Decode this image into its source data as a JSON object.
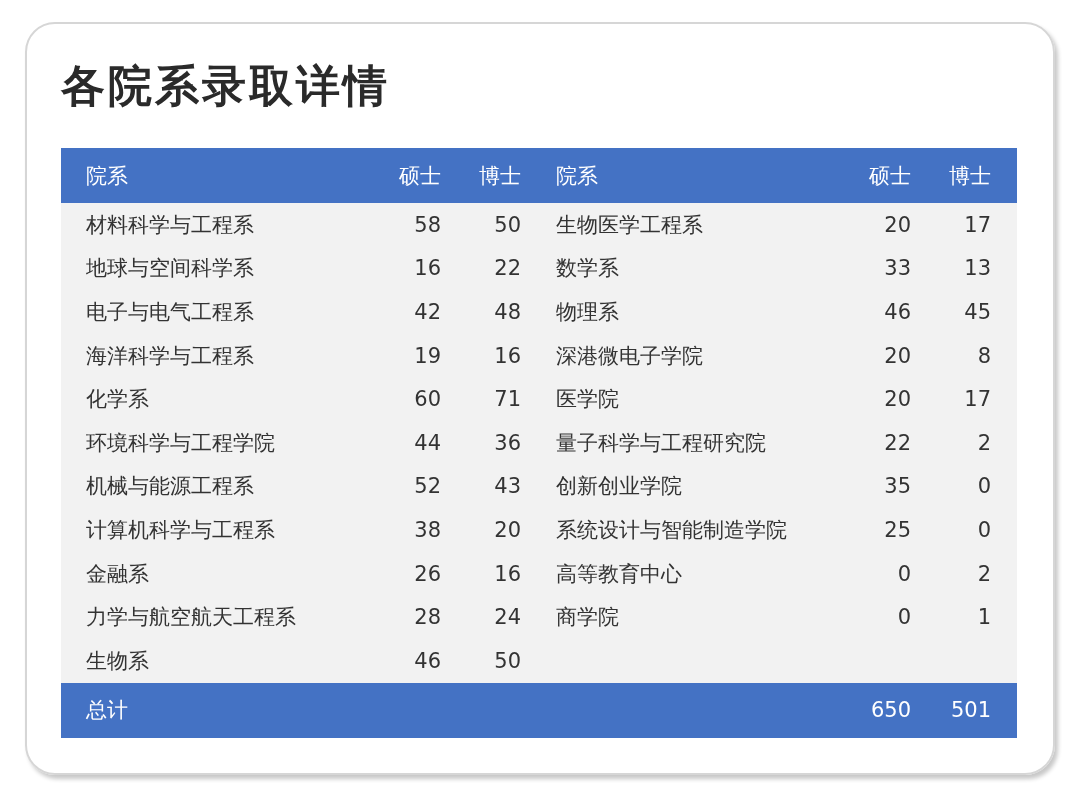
{
  "title": "各院系录取详情",
  "table": {
    "columns": [
      "院系",
      "硕士",
      "博士",
      "院系",
      "硕士",
      "博士"
    ],
    "rows": [
      [
        "材料科学与工程系",
        "58",
        "50",
        "生物医学工程系",
        "20",
        "17"
      ],
      [
        "地球与空间科学系",
        "16",
        "22",
        "数学系",
        "33",
        "13"
      ],
      [
        "电子与电气工程系",
        "42",
        "48",
        "物理系",
        "46",
        "45"
      ],
      [
        "海洋科学与工程系",
        "19",
        "16",
        "深港微电子学院",
        "20",
        "8"
      ],
      [
        "化学系",
        "60",
        "71",
        "医学院",
        "20",
        "17"
      ],
      [
        "环境科学与工程学院",
        "44",
        "36",
        "量子科学与工程研究院",
        "22",
        "2"
      ],
      [
        "机械与能源工程系",
        "52",
        "43",
        "创新创业学院",
        "35",
        "0"
      ],
      [
        "计算机科学与工程系",
        "38",
        "20",
        "系统设计与智能制造学院",
        "25",
        "0"
      ],
      [
        "金融系",
        "26",
        "16",
        "高等教育中心",
        "0",
        "2"
      ],
      [
        "力学与航空航天工程系",
        "28",
        "24",
        "商学院",
        "0",
        "1"
      ],
      [
        "生物系",
        "46",
        "50"
      ]
    ],
    "total": {
      "label": "总计",
      "masters": "650",
      "doctors": "501"
    }
  }
}
